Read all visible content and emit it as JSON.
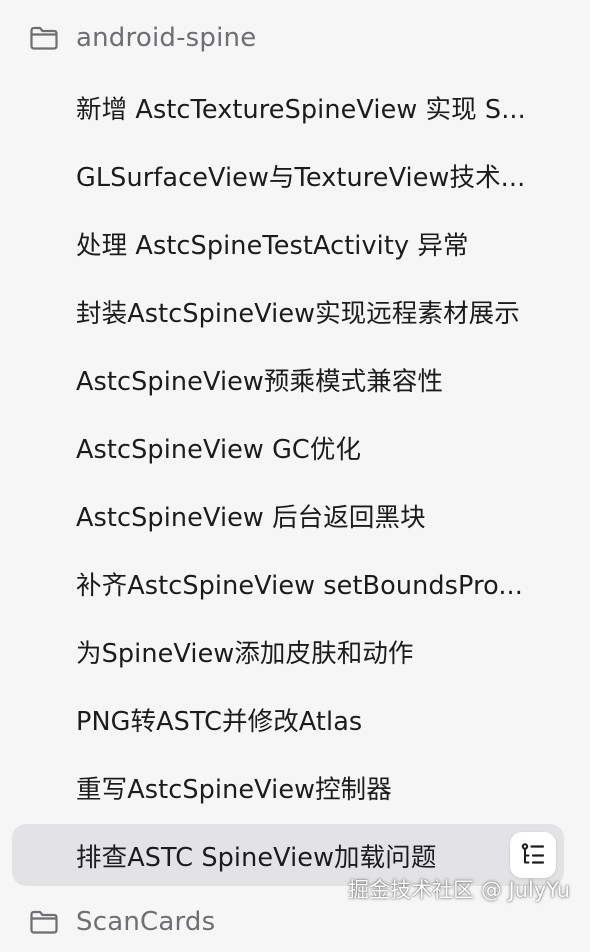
{
  "folders": [
    {
      "name": "android-spine"
    },
    {
      "name": "ScanCards"
    }
  ],
  "items": [
    {
      "label": "新增 AstcTextureSpineView 实现 S..."
    },
    {
      "label": "GLSurfaceView与TextureView技术..."
    },
    {
      "label": "处理 AstcSpineTestActivity 异常"
    },
    {
      "label": "封装AstcSpineView实现远程素材展示"
    },
    {
      "label": "AstcSpineView预乘模式兼容性"
    },
    {
      "label": "AstcSpineView GC优化"
    },
    {
      "label": "AstcSpineView 后台返回黑块"
    },
    {
      "label": "补齐AstcSpineView setBoundsPro..."
    },
    {
      "label": "为SpineView添加皮肤和动作"
    },
    {
      "label": "PNG转ASTC并修改Atlas"
    },
    {
      "label": "重写AstcSpineView控制器"
    },
    {
      "label": "排查ASTC SpineView加载问题"
    }
  ],
  "selected_index": 11,
  "icons": {
    "folder": "folder-icon",
    "outline": "outline-list-icon"
  },
  "watermark": "掘金技术社区 @ JulyYu",
  "colors": {
    "background": "#f6f6f6",
    "selected": "#e3e3e5",
    "folder_text": "#6e6e73",
    "item_text": "#1c1c1e"
  }
}
